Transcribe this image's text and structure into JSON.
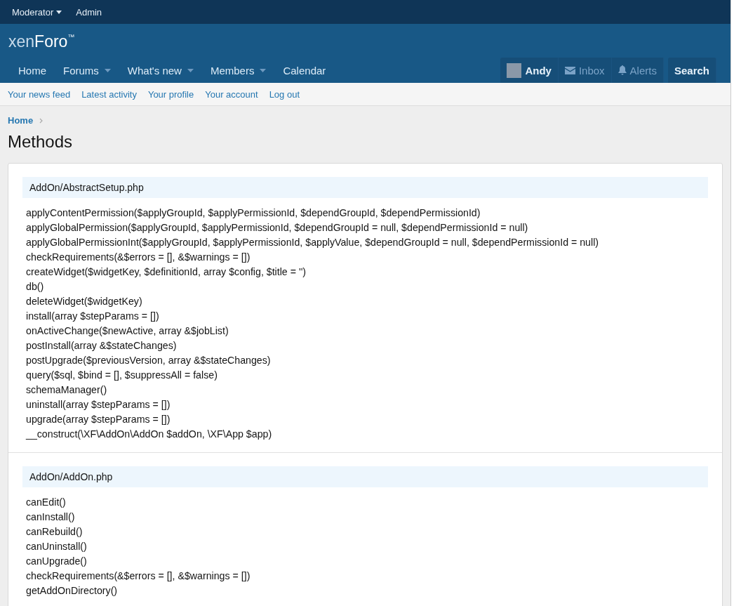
{
  "staff_bar": [
    {
      "label": "Moderator",
      "has_menu": true
    },
    {
      "label": "Admin",
      "has_menu": false
    }
  ],
  "logo": {
    "light": "xen",
    "bold": "Foro",
    "mark": "™"
  },
  "nav": [
    {
      "label": "Home",
      "has_menu": false
    },
    {
      "label": "Forums",
      "has_menu": true
    },
    {
      "label": "What's new",
      "has_menu": true
    },
    {
      "label": "Members",
      "has_menu": true
    },
    {
      "label": "Calendar",
      "has_menu": false
    }
  ],
  "user_nav": [
    {
      "kind": "user",
      "label": "Andy",
      "dimmed": false
    },
    {
      "kind": "inbox",
      "label": "Inbox",
      "dimmed": true
    },
    {
      "kind": "alerts",
      "label": "Alerts",
      "dimmed": true
    },
    {
      "kind": "search",
      "label": "Search",
      "dimmed": false
    }
  ],
  "sub_nav": [
    "Your news feed",
    "Latest activity",
    "Your profile",
    "Your account",
    "Log out"
  ],
  "breadcrumb": [
    "Home"
  ],
  "title": "Methods",
  "sections": [
    {
      "file": "AddOn/AbstractSetup.php",
      "methods": [
        "applyContentPermission($applyGroupId, $applyPermissionId, $dependGroupId, $dependPermissionId)",
        "applyGlobalPermission($applyGroupId, $applyPermissionId, $dependGroupId = null, $dependPermissionId = null)",
        "applyGlobalPermissionInt($applyGroupId, $applyPermissionId, $applyValue, $dependGroupId = null, $dependPermissionId = null)",
        "checkRequirements(&$errors = [], &$warnings = [])",
        "createWidget($widgetKey, $definitionId, array $config, $title = '')",
        "db()",
        "deleteWidget($widgetKey)",
        "install(array $stepParams = [])",
        "onActiveChange($newActive, array &$jobList)",
        "postInstall(array &$stateChanges)",
        "postUpgrade($previousVersion, array &$stateChanges)",
        "query($sql, $bind = [], $suppressAll = false)",
        "schemaManager()",
        "uninstall(array $stepParams = [])",
        "upgrade(array $stepParams = [])",
        "__construct(\\XF\\AddOn\\AddOn $addOn, \\XF\\App $app)"
      ]
    },
    {
      "file": "AddOn/AddOn.php",
      "methods": [
        "canEdit()",
        "canInstall()",
        "canRebuild()",
        "canUninstall()",
        "canUpgrade()",
        "checkRequirements(&$errors = [], &$warnings = [])",
        "getAddOnDirectory()"
      ]
    }
  ]
}
